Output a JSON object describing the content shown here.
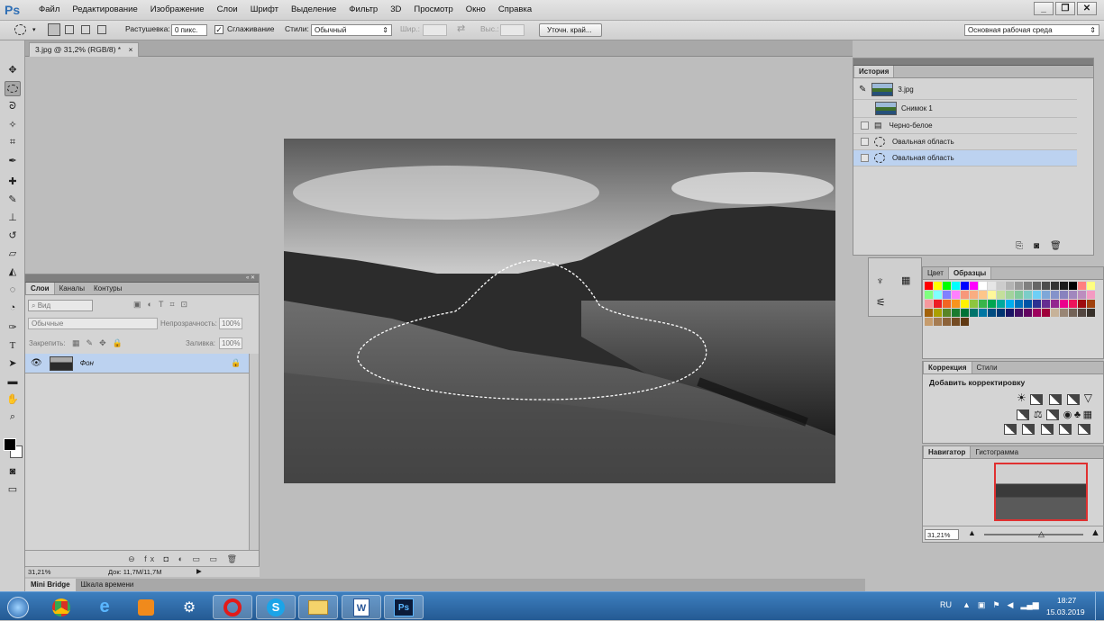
{
  "app": {
    "logo": "Ps",
    "menu": [
      "Файл",
      "Редактирование",
      "Изображение",
      "Слои",
      "Шрифт",
      "Выделение",
      "Фильтр",
      "3D",
      "Просмотр",
      "Окно",
      "Справка"
    ],
    "win_min": "_",
    "win_max": "❐",
    "win_close": "✕"
  },
  "options": {
    "feather_label": "Растушевка:",
    "feather_value": "0 пикс.",
    "antialias_label": "Сглаживание",
    "antialias_checked": "✓",
    "style_label": "Стили:",
    "style_value": "Обычный",
    "width_label": "Шир.:",
    "height_label": "Выс.:",
    "refine_button": "Уточн. край...",
    "workspace": "Основная рабочая среда"
  },
  "document": {
    "tab_title": "3.jpg @ 31,2% (RGB/8) *",
    "tab_close": "×"
  },
  "history": {
    "title": "История",
    "items": [
      {
        "label": "3.jpg"
      },
      {
        "label": "Снимок 1"
      },
      {
        "label": "Черно-белое"
      },
      {
        "label": "Овальная область"
      },
      {
        "label": "Овальная область"
      }
    ]
  },
  "layers": {
    "tabs": [
      "Слои",
      "Каналы",
      "Контуры"
    ],
    "kind": "Вид",
    "blend": "Обычные",
    "opacity_label": "Непрозрачность:",
    "opacity": "100%",
    "lock_label": "Закрепить:",
    "fill_label": "Заливка:",
    "fill": "100%",
    "layer_name": "Фон",
    "footer_icons": "⊖ fx ◘ ◐ ▭ ▭ 🗑"
  },
  "swatches": {
    "tabs": [
      "Цвет",
      "Образцы"
    ],
    "colors": [
      "#ff0000",
      "#ffff00",
      "#00ff00",
      "#00ffff",
      "#0000ff",
      "#ff00ff",
      "#ffffff",
      "#e6e6e6",
      "#cccccc",
      "#b3b3b3",
      "#999999",
      "#808080",
      "#666666",
      "#4d4d4d",
      "#333333",
      "#1a1a1a",
      "#000000",
      "#ff8080",
      "#ffff80",
      "#80ff80",
      "#80ffff",
      "#8080ff",
      "#ff80ff",
      "#f7977a",
      "#f9ad81",
      "#fdc68a",
      "#fff79a",
      "#c4df9b",
      "#a2d39c",
      "#82ca9d",
      "#7bcdc8",
      "#6ecff6",
      "#7ea7d8",
      "#8493ca",
      "#8882be",
      "#a187be",
      "#bc8dbf",
      "#f49ac2",
      "#f6989d",
      "#ed1c24",
      "#f26522",
      "#f7941d",
      "#fff200",
      "#8dc63f",
      "#39b54a",
      "#00a651",
      "#00a99d",
      "#00aeef",
      "#0072bc",
      "#0054a6",
      "#2e3192",
      "#662d91",
      "#92278f",
      "#ec008c",
      "#ed145b",
      "#9e0b0f",
      "#a0410d",
      "#a3620a",
      "#aba000",
      "#598527",
      "#1a7b30",
      "#007236",
      "#00746b",
      "#0076a3",
      "#004b80",
      "#003471",
      "#1b1464",
      "#440e62",
      "#630460",
      "#9e005d",
      "#9e0039",
      "#c7b299",
      "#998675",
      "#736357",
      "#534741",
      "#37302a",
      "#c69c6d",
      "#a67c52",
      "#8c6239",
      "#754c24",
      "#603913"
    ]
  },
  "adjustments": {
    "tabs": [
      "Коррекция",
      "Стили"
    ],
    "title": "Добавить корректировку"
  },
  "navigator": {
    "tabs": [
      "Навигатор",
      "Гистограмма"
    ],
    "zoom": "31,21%"
  },
  "status": {
    "zoom": "31,21%",
    "doc": "Док: 11,7M/11,7M"
  },
  "bottom_tabs": [
    "Mini Bridge",
    "Шкала времени"
  ],
  "taskbar": {
    "lang": "RU",
    "time": "18:27",
    "date": "15.03.2019"
  }
}
